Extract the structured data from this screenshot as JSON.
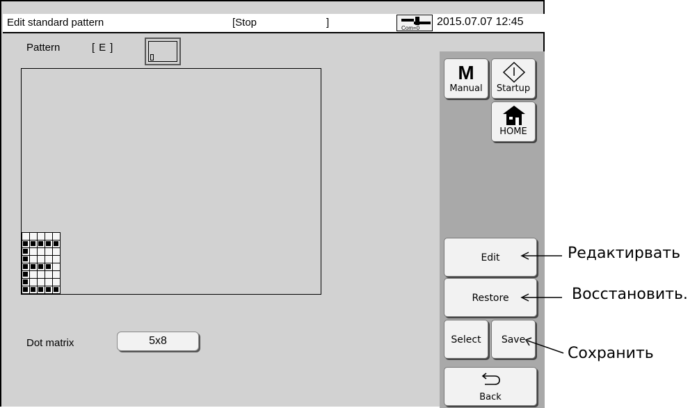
{
  "header": {
    "title": "Edit standard pattern",
    "status_open": "[Stop",
    "status_close": "]",
    "com_label": "Com=0",
    "datetime": "2015.07.07 12:45"
  },
  "pattern": {
    "label": "Pattern",
    "code": "[E]",
    "grid_cols": 5,
    "grid_rows": 8,
    "matrix": [
      [
        0,
        0,
        0,
        0,
        0
      ],
      [
        1,
        1,
        1,
        1,
        1
      ],
      [
        1,
        0,
        0,
        0,
        0
      ],
      [
        1,
        0,
        0,
        0,
        0
      ],
      [
        1,
        1,
        1,
        1,
        0
      ],
      [
        1,
        0,
        0,
        0,
        0
      ],
      [
        1,
        0,
        0,
        0,
        0
      ],
      [
        1,
        1,
        1,
        1,
        1
      ]
    ]
  },
  "dot_matrix": {
    "label": "Dot matrix",
    "value": "5x8"
  },
  "sidebar": {
    "manual_glyph": "M",
    "manual_label": "Manual",
    "startup_label": "Startup",
    "home_label": "HOME",
    "edit_label": "Edit",
    "restore_label": "Restore",
    "select_label": "Select",
    "save_label": "Save",
    "back_label": "Back"
  },
  "annotations": {
    "edit": "Редактирвать",
    "restore": "Восстановить.",
    "save": "Сохранить"
  },
  "colors": {
    "screen_bg": "#d2d2d2",
    "sidebar_bg": "#a9a9a9",
    "button_bg": "#f2f2f2"
  }
}
